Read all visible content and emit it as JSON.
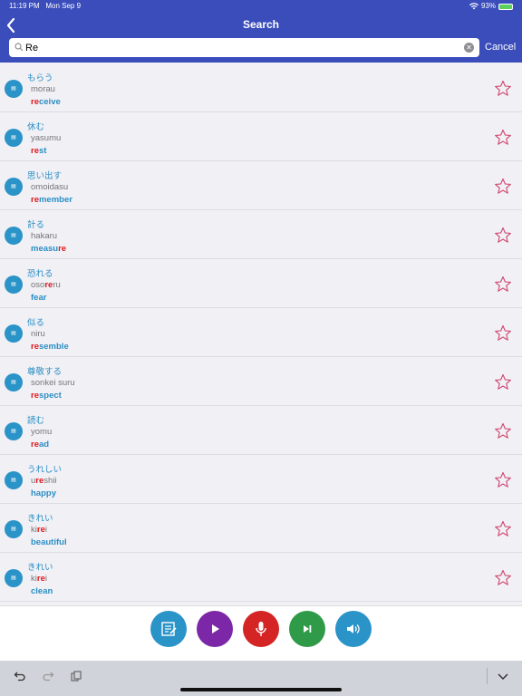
{
  "status": {
    "time": "11:19 PM",
    "date": "Mon Sep 9",
    "battery": "93%"
  },
  "nav": {
    "title": "Search"
  },
  "search": {
    "value": "Re",
    "cancel_label": "Cancel"
  },
  "results": [
    {
      "jp": "もらう",
      "romaji": [
        [
          "morau",
          ""
        ]
      ],
      "en": [
        [
          "re",
          "hl"
        ],
        [
          "ceive",
          ""
        ]
      ]
    },
    {
      "jp": "休む",
      "romaji": [
        [
          "yasumu",
          ""
        ]
      ],
      "en": [
        [
          "re",
          "hl"
        ],
        [
          "st",
          ""
        ]
      ]
    },
    {
      "jp": "思い出す",
      "romaji": [
        [
          "omoidasu",
          ""
        ]
      ],
      "en": [
        [
          "re",
          "hl"
        ],
        [
          "member",
          ""
        ]
      ]
    },
    {
      "jp": "計る",
      "romaji": [
        [
          "hakaru",
          ""
        ]
      ],
      "en": [
        [
          "measu",
          ""
        ],
        [
          "re",
          "hl"
        ]
      ]
    },
    {
      "jp": "恐れる",
      "romaji": [
        [
          "oso",
          ""
        ],
        [
          "re",
          "hl"
        ],
        [
          "ru",
          ""
        ]
      ],
      "en": [
        [
          "fear",
          ""
        ]
      ]
    },
    {
      "jp": "似る",
      "romaji": [
        [
          "niru",
          ""
        ]
      ],
      "en": [
        [
          "re",
          "hl"
        ],
        [
          "semble",
          ""
        ]
      ]
    },
    {
      "jp": "尊敬する",
      "romaji": [
        [
          "sonkei suru",
          ""
        ]
      ],
      "en": [
        [
          "re",
          "hl"
        ],
        [
          "spect",
          ""
        ]
      ]
    },
    {
      "jp": "読む",
      "romaji": [
        [
          "yomu",
          ""
        ]
      ],
      "en": [
        [
          "re",
          "hl"
        ],
        [
          "ad",
          ""
        ]
      ]
    },
    {
      "jp": "うれしい",
      "romaji": [
        [
          "u",
          ""
        ],
        [
          "re",
          "hl"
        ],
        [
          "shii",
          ""
        ]
      ],
      "en": [
        [
          "happy",
          ""
        ]
      ]
    },
    {
      "jp": "きれい",
      "romaji": [
        [
          "ki",
          ""
        ],
        [
          "re",
          "hl"
        ],
        [
          "i",
          ""
        ]
      ],
      "en": [
        [
          "beautiful",
          ""
        ]
      ]
    },
    {
      "jp": "きれい",
      "romaji": [
        [
          "ki",
          ""
        ],
        [
          "re",
          "hl"
        ],
        [
          "i",
          ""
        ]
      ],
      "en": [
        [
          "clean",
          ""
        ]
      ]
    }
  ],
  "icons": {
    "badge": "speech-badge-icon",
    "favorite": "star-outline-icon",
    "bottom": [
      "notes-icon",
      "play-icon",
      "microphone-icon",
      "skip-next-icon",
      "speaker-icon"
    ]
  },
  "colors": {
    "accent": "#3a4dbb",
    "link": "#2a8ec5",
    "highlight": "#e0161b",
    "star": "#d0436c",
    "btn_notes": "#2a93c8",
    "btn_play": "#7b27a8",
    "btn_mic": "#d42424",
    "btn_next": "#2f9a48",
    "btn_speaker": "#2a93c8"
  }
}
